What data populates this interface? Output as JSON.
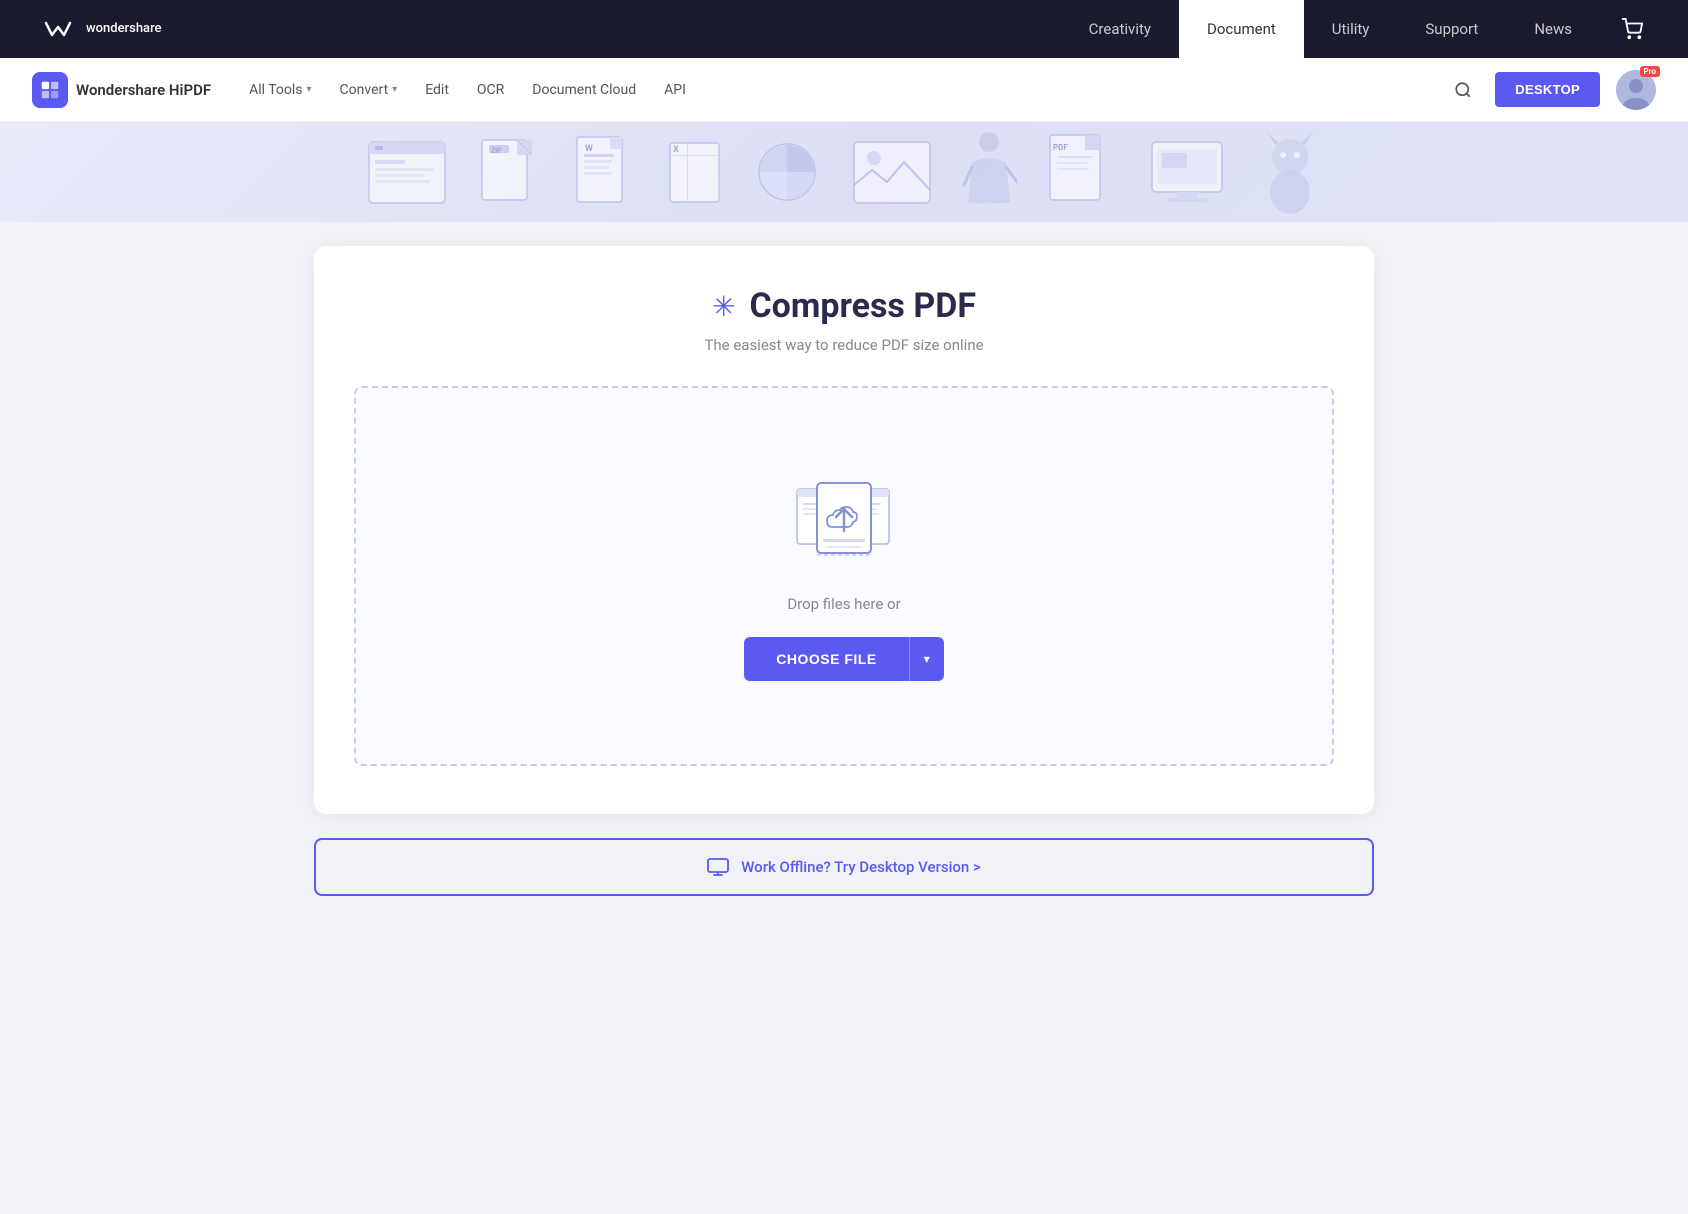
{
  "topNav": {
    "brand": {
      "name": "wondershare"
    },
    "links": [
      {
        "label": "Creativity",
        "active": false
      },
      {
        "label": "Document",
        "active": true
      },
      {
        "label": "Utility",
        "active": false
      },
      {
        "label": "Support",
        "active": false
      },
      {
        "label": "News",
        "active": false
      }
    ],
    "cartIcon": "🛒"
  },
  "secondaryNav": {
    "brand": "Wondershare HiPDF",
    "links": [
      {
        "label": "All Tools",
        "hasDropdown": true
      },
      {
        "label": "Convert",
        "hasDropdown": true
      },
      {
        "label": "Edit",
        "hasDropdown": false
      },
      {
        "label": "OCR",
        "hasDropdown": false
      },
      {
        "label": "Document Cloud",
        "hasDropdown": false
      },
      {
        "label": "API",
        "hasDropdown": false
      }
    ],
    "desktopButtonLabel": "DESKTOP",
    "proBadge": "Pro"
  },
  "page": {
    "title": "Compress PDF",
    "titleIcon": "✳",
    "subtitle": "The easiest way to reduce PDF size online",
    "dropZone": {
      "dropText": "Drop files here or",
      "chooseFileLabel": "CHOOSE FILE"
    },
    "offlineBanner": {
      "text": "Work Offline? Try Desktop Version >"
    }
  },
  "colors": {
    "accent": "#5a5af0",
    "accentLight": "#e8eaf8",
    "textDark": "#2a2a4a",
    "textMuted": "#888888",
    "borderDash": "#c8cce8"
  }
}
